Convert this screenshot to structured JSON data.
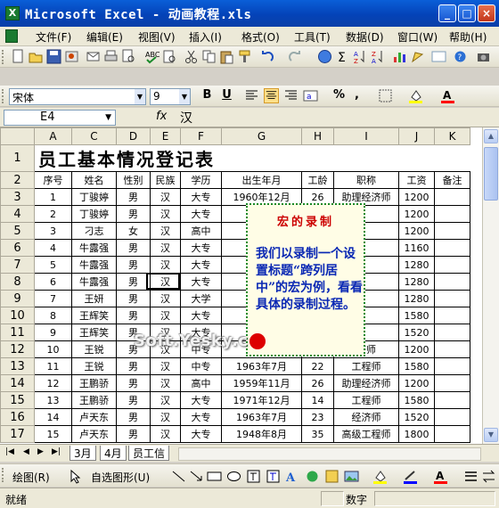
{
  "window": {
    "title": "Microsoft Excel - 动画教程.xls",
    "app_icon_letter": "X"
  },
  "menu": [
    "文件(F)",
    "编辑(E)",
    "视图(V)",
    "插入(I)",
    "格式(O)",
    "工具(T)",
    "数据(D)",
    "窗口(W)",
    "帮助(H)"
  ],
  "format": {
    "font": "宋体",
    "size": "9",
    "bold": "B",
    "underline": "U",
    "percent": "%",
    "comma": ","
  },
  "formula_bar": {
    "cell_ref": "E4",
    "fx": "fx",
    "value": "汉"
  },
  "columns": [
    "A",
    "C",
    "D",
    "E",
    "F",
    "G",
    "H",
    "I",
    "J",
    "K"
  ],
  "sheet_title": "员工基本情况登记表",
  "headers": [
    "序号",
    "姓名",
    "性别",
    "民族",
    "学历",
    "出生年月",
    "工龄",
    "职称",
    "工资",
    "备注"
  ],
  "rows": [
    [
      "1",
      "丁骏婷",
      "男",
      "汉",
      "大专",
      "1960年12月",
      "26",
      "助理经济师",
      "1200",
      ""
    ],
    [
      "2",
      "丁骏婷",
      "男",
      "汉",
      "大专",
      "195",
      "",
      "",
      "1200",
      ""
    ],
    [
      "3",
      "刁志",
      "女",
      "汉",
      "高中",
      "196",
      "",
      "",
      "1200",
      ""
    ],
    [
      "4",
      "牛露强",
      "男",
      "汉",
      "大专",
      "196",
      "",
      "",
      "1160",
      ""
    ],
    [
      "5",
      "牛露强",
      "男",
      "汉",
      "大专",
      "194",
      "",
      "",
      "1280",
      ""
    ],
    [
      "6",
      "牛露强",
      "男",
      "汉",
      "大专",
      "194",
      "",
      "",
      "1280",
      ""
    ],
    [
      "7",
      "王妍",
      "男",
      "汉",
      "大学",
      "197",
      "",
      "",
      "1280",
      ""
    ],
    [
      "8",
      "王辉笑",
      "男",
      "汉",
      "大专",
      "196",
      "",
      "",
      "1580",
      ""
    ],
    [
      "9",
      "王辉笑",
      "男",
      "汉",
      "大专",
      "196",
      "",
      "",
      "1520",
      ""
    ],
    [
      "10",
      "王锐",
      "男",
      "汉",
      "中专",
      "196",
      "",
      "济师",
      "1200",
      ""
    ],
    [
      "11",
      "王锐",
      "男",
      "汉",
      "中专",
      "1963年7月",
      "22",
      "工程师",
      "1580",
      ""
    ],
    [
      "12",
      "王鹏骄",
      "男",
      "汉",
      "高中",
      "1959年11月",
      "26",
      "助理经济师",
      "1200",
      ""
    ],
    [
      "13",
      "王鹏骄",
      "男",
      "汉",
      "大专",
      "1971年12月",
      "14",
      "工程师",
      "1580",
      ""
    ],
    [
      "14",
      "卢天东",
      "男",
      "汉",
      "大专",
      "1963年7月",
      "23",
      "经济师",
      "1520",
      ""
    ],
    [
      "15",
      "卢天东",
      "男",
      "汉",
      "大专",
      "1948年8月",
      "35",
      "高级工程师",
      "1800",
      ""
    ]
  ],
  "row_numbers": [
    "1",
    "2",
    "3",
    "4",
    "5",
    "6",
    "7",
    "8",
    "9",
    "10",
    "11",
    "12",
    "13",
    "14",
    "15",
    "16",
    "17"
  ],
  "callout": {
    "title": "宏的录制",
    "body": "我们以录制一个设置标题“跨列居中”的宏为例，看看具体的录制过程。"
  },
  "watermark": "Soft.Yesky.c",
  "tabs": [
    "3月",
    "4月",
    "员工信"
  ],
  "drawing": {
    "draw_label": "绘图(R)",
    "autoshape_label": "自选图形(U)"
  },
  "status": {
    "ready": "就绪",
    "num": "数字"
  }
}
